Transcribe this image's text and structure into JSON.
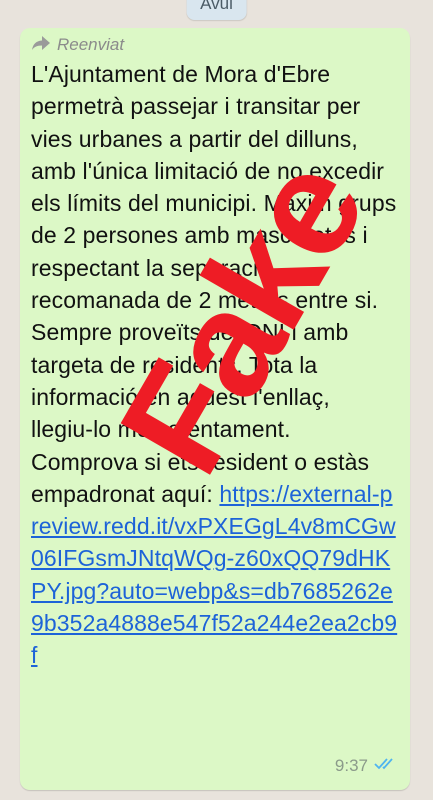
{
  "date_chip": "Avui",
  "message": {
    "forwarded_label": "Reenviat",
    "body_text": "L'Ajuntament de Mora d'Ebre permetrà passejar i transitar per vies urbanes a partir del dilluns, amb l'única limitació de no excedir els límits del municipi. Màxim grups de 2 persones amb mascaretes i respectant la separació recomanada de 2 metres entre si. Sempre proveïts del DNI i amb targeta de residents. Tota la informació en aquest l'enllaç, llegiu-lo molt atentament. Comprova si ets resident o estàs empadronat aquí:",
    "link": "https://external-preview.redd.it/vxPXEGgL4v8mCGw06IFGsmJNtqWQg-z60xQQ79dHKPY.jpg?auto=webp&s=db7685262e9b352a4888e547f52a244e2ea2cb9f",
    "time": "9:37",
    "status_icon": "double-check-icon"
  },
  "overlay": {
    "stamp_text": "Fake",
    "stamp_color": "#ee1c25"
  },
  "colors": {
    "bubble": "#dcf8c6",
    "link": "#1d63d8",
    "read_ticks": "#4fb4f0"
  }
}
